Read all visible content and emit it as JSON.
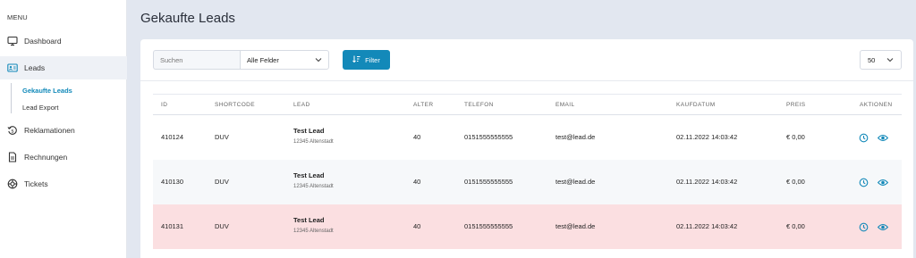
{
  "sidebar": {
    "menu_label": "MENU",
    "items": [
      {
        "label": "Dashboard",
        "icon": "monitor-icon"
      },
      {
        "label": "Leads",
        "icon": "contact-card-icon"
      },
      {
        "label": "Reklamationen",
        "icon": "euro-refund-icon"
      },
      {
        "label": "Rechnungen",
        "icon": "invoice-icon"
      },
      {
        "label": "Tickets",
        "icon": "support-ring-icon"
      }
    ],
    "sub_items": [
      {
        "label": "Gekaufte Leads"
      },
      {
        "label": "Lead Export"
      }
    ]
  },
  "page": {
    "title": "Gekaufte Leads"
  },
  "toolbar": {
    "search_placeholder": "Suchen",
    "field_select_value": "Alle Felder",
    "filter_label": "Filter",
    "per_page_value": "50"
  },
  "table": {
    "headers": [
      "ID",
      "SHORTCODE",
      "LEAD",
      "ALTER",
      "TELEFON",
      "EMAIL",
      "KAUFDATUM",
      "PREIS",
      "AKTIONEN"
    ],
    "rows": [
      {
        "id": "410124",
        "shortcode": "DUV",
        "lead_name": "Test Lead",
        "lead_city": "12345 Altenstadt",
        "alter": "40",
        "telefon": "0151555555555",
        "email": "test@lead.de",
        "kaufdatum": "02.11.2022 14:03:42",
        "preis": "€ 0,00"
      },
      {
        "id": "410130",
        "shortcode": "DUV",
        "lead_name": "Test Lead",
        "lead_city": "12345 Altenstadt",
        "alter": "40",
        "telefon": "0151555555555",
        "email": "test@lead.de",
        "kaufdatum": "02.11.2022 14:03:42",
        "preis": "€ 0,00"
      },
      {
        "id": "410131",
        "shortcode": "DUV",
        "lead_name": "Test Lead",
        "lead_city": "12345 Altenstadt",
        "alter": "40",
        "telefon": "0151555555555",
        "email": "test@lead.de",
        "kaufdatum": "02.11.2022 14:03:42",
        "preis": "€ 0,00"
      }
    ]
  },
  "colors": {
    "accent": "#1389b9",
    "highlight_row": "#fbdfe1",
    "alt_row": "#f6f8fa",
    "background": "#e2e7f0"
  }
}
